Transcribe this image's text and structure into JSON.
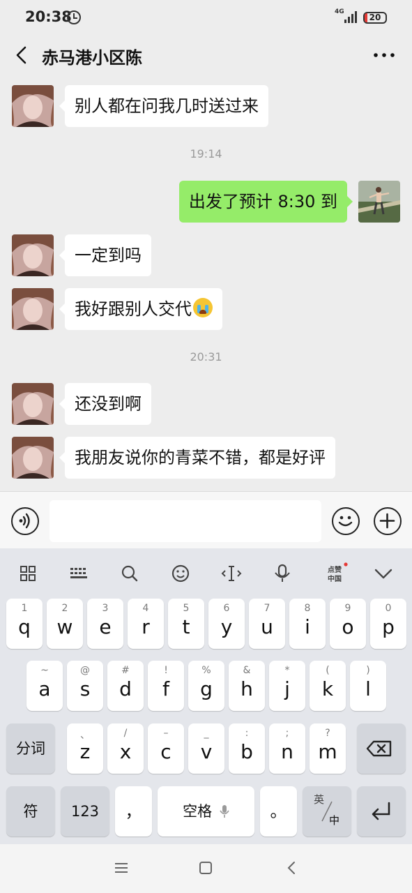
{
  "status_bar": {
    "time": "20:38",
    "network": "4G",
    "battery": "20"
  },
  "header": {
    "title": "赤马港小区陈"
  },
  "messages": [
    {
      "side": "left",
      "text": "别人都在问我几时送过来"
    },
    {
      "timestamp": "19:14"
    },
    {
      "side": "right",
      "text": "出发了预计 8:30 到"
    },
    {
      "side": "left",
      "text": "一定到吗"
    },
    {
      "side": "left",
      "text": "我好跟别人交代"
    },
    {
      "timestamp": "20:31"
    },
    {
      "side": "left",
      "text": "还没到啊"
    },
    {
      "side": "left",
      "text": "我朋友说你的青菜不错，都是好评"
    }
  ],
  "input": {
    "value": ""
  },
  "keyboard": {
    "toolbar": [
      "apps-grid-icon",
      "keyboard-layout-icon",
      "search-icon",
      "emoji-icon",
      "cursor-icon",
      "mic-icon",
      "点赞中国",
      "collapse-icon"
    ],
    "row1": [
      {
        "k": "q",
        "s": "1"
      },
      {
        "k": "w",
        "s": "2"
      },
      {
        "k": "e",
        "s": "3"
      },
      {
        "k": "r",
        "s": "4"
      },
      {
        "k": "t",
        "s": "5"
      },
      {
        "k": "y",
        "s": "6"
      },
      {
        "k": "u",
        "s": "7"
      },
      {
        "k": "i",
        "s": "8"
      },
      {
        "k": "o",
        "s": "9"
      },
      {
        "k": "p",
        "s": "0"
      }
    ],
    "row2": [
      {
        "k": "a",
        "s": "~"
      },
      {
        "k": "s",
        "s": "@"
      },
      {
        "k": "d",
        "s": "#"
      },
      {
        "k": "f",
        "s": "!"
      },
      {
        "k": "g",
        "s": "%"
      },
      {
        "k": "h",
        "s": "&"
      },
      {
        "k": "j",
        "s": "*"
      },
      {
        "k": "k",
        "s": "("
      },
      {
        "k": "l",
        "s": ")"
      }
    ],
    "row3": [
      {
        "k": "z",
        "s": "、"
      },
      {
        "k": "x",
        "s": "/"
      },
      {
        "k": "c",
        "s": "–"
      },
      {
        "k": "v",
        "s": "_"
      },
      {
        "k": "b",
        "s": ":"
      },
      {
        "k": "n",
        "s": ";"
      },
      {
        "k": "m",
        "s": "?"
      }
    ],
    "fenci": "分词",
    "fu": "符",
    "num": "123",
    "comma": "，",
    "space": "空格",
    "period": "。",
    "lang_top": "英",
    "lang_bottom": "中"
  }
}
